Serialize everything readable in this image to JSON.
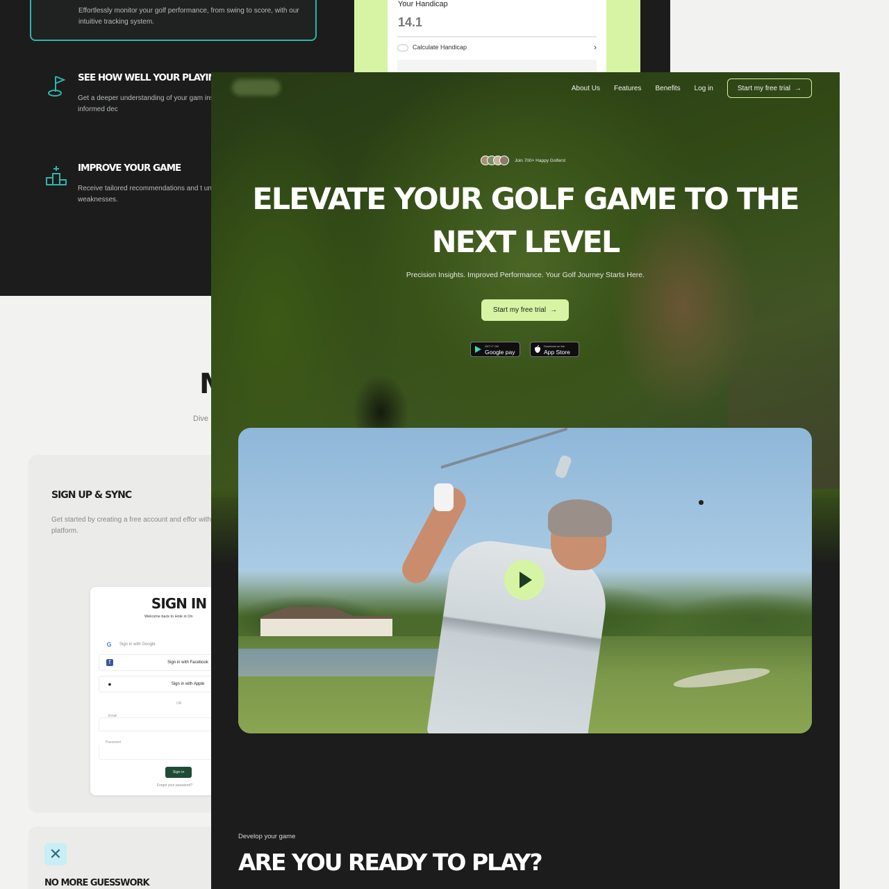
{
  "features_section": {
    "top_card_desc": "Effortlessly monitor your golf performance, from swing to score, with our intuitive tracking system.",
    "items": [
      {
        "title": "SEE HOW WELL YOUR PLAYING",
        "desc": "Get a deeper understanding of your gam insights, helping you make informed dec",
        "icon": "golf-flag-icon"
      },
      {
        "title": "IMPROVE YOUR GAME",
        "desc": "Receive tailored recommendations and t unique playing style and weaknesses.",
        "icon": "podium-icon"
      }
    ]
  },
  "handicap_card": {
    "label": "Your Handicap",
    "value": "14.1",
    "calc_label": "Calculate Handicap",
    "chevron": "›"
  },
  "left_section": {
    "cut_title": "M",
    "cut_sub": "Dive",
    "step": {
      "title": "SIGN UP & SYNC",
      "desc": "Get started by creating a free account and effor with our platform."
    },
    "signin": {
      "title": "SIGN IN",
      "subtitle": "Welcome back to Hole in On",
      "google": "Sign in with Google",
      "facebook": "Sign in with Facebook",
      "apple": "Sign in with Apple",
      "or": "OR",
      "field1_label": "Email",
      "field2_label": "Password",
      "button": "Sign in",
      "forgot": "Forgot your password?"
    },
    "guess": {
      "title": "NO MORE GUESSWORK",
      "icon": "close-icon"
    }
  },
  "hero": {
    "nav": [
      "About Us",
      "Features",
      "Benefits",
      "Log in"
    ],
    "nav_cta": "Start my free trial",
    "join_text": "Join 700+ Happy Golfers!",
    "title": "ELEVATE YOUR GOLF GAME TO THE NEXT LEVEL",
    "subtitle": "Precision Insights. Improved Performance. Your Golf Journey Starts Here.",
    "cta": "Start my free trial",
    "google_badge_small": "GET IT ON",
    "google_badge": "Google pay",
    "apple_badge_small": "Download on the",
    "apple_badge": "App Store",
    "arrow": "→"
  },
  "lower": {
    "eyebrow": "Develop your game",
    "title": "ARE YOU READY TO PLAY?"
  },
  "colors": {
    "accent_lime": "#d6f4a3",
    "dark_bg": "#1b1c1b",
    "teal": "#2fb4ad"
  }
}
